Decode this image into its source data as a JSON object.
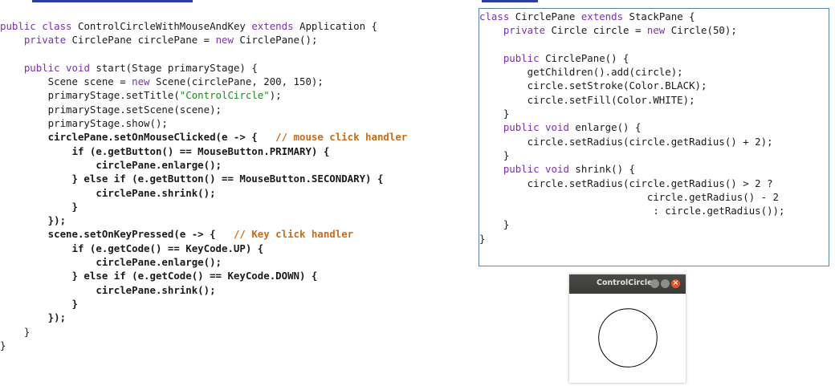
{
  "window": {
    "title": "ControlCircle",
    "close_glyph": "×",
    "circle_radius": 50
  },
  "left_code": [
    [
      {
        "t": "public class ",
        "c": "kw"
      },
      {
        "t": "ControlCircleWithMouseAndKey "
      },
      {
        "t": "extends ",
        "c": "kw"
      },
      {
        "t": "Application {"
      }
    ],
    [
      {
        "t": "    "
      },
      {
        "t": "private ",
        "c": "kw"
      },
      {
        "t": "CirclePane circlePane = "
      },
      {
        "t": "new ",
        "c": "kw"
      },
      {
        "t": "CirclePane();"
      }
    ],
    [],
    [
      {
        "t": "    "
      },
      {
        "t": "public void ",
        "c": "kw"
      },
      {
        "t": "start(Stage primaryStage) {"
      }
    ],
    [
      {
        "t": "        Scene scene = "
      },
      {
        "t": "new ",
        "c": "kw"
      },
      {
        "t": "Scene(circlePane, 200, 150);"
      }
    ],
    [
      {
        "t": "        primaryStage.setTitle("
      },
      {
        "t": "\"ControlCircle\"",
        "c": "str"
      },
      {
        "t": ");"
      }
    ],
    [
      {
        "t": "        primaryStage.setScene(scene);"
      }
    ],
    [
      {
        "t": "        primaryStage.show();"
      }
    ],
    [
      {
        "t": "        circlePane.setOnMouseClicked(e -> {   ",
        "c": "b"
      },
      {
        "t": "// mouse click handler",
        "c": "cm b"
      }
    ],
    [
      {
        "t": "            if (e.getButton() == MouseButton.PRIMARY) {",
        "c": "b"
      }
    ],
    [
      {
        "t": "                circlePane.enlarge();",
        "c": "b"
      }
    ],
    [
      {
        "t": "            } else if (e.getButton() == MouseButton.SECONDARY) {",
        "c": "b"
      }
    ],
    [
      {
        "t": "                circlePane.shrink();",
        "c": "b"
      }
    ],
    [
      {
        "t": "            }",
        "c": "b"
      }
    ],
    [
      {
        "t": "        });",
        "c": "b"
      }
    ],
    [
      {
        "t": "        scene.setOnKeyPressed(e -> {   ",
        "c": "b"
      },
      {
        "t": "// Key click handler",
        "c": "cm b"
      }
    ],
    [
      {
        "t": "            if (e.getCode() == KeyCode.UP) {",
        "c": "b"
      }
    ],
    [
      {
        "t": "                circlePane.enlarge();",
        "c": "b"
      }
    ],
    [
      {
        "t": "            } else if (e.getCode() == KeyCode.DOWN) {",
        "c": "b"
      }
    ],
    [
      {
        "t": "                circlePane.shrink();",
        "c": "b"
      }
    ],
    [
      {
        "t": "            }",
        "c": "b"
      }
    ],
    [
      {
        "t": "        });",
        "c": "b"
      }
    ],
    [
      {
        "t": "    }"
      }
    ],
    [
      {
        "t": "}"
      }
    ]
  ],
  "right_code": [
    [
      {
        "t": "class ",
        "c": "kw"
      },
      {
        "t": "CirclePane "
      },
      {
        "t": "extends ",
        "c": "kw"
      },
      {
        "t": "StackPane {"
      }
    ],
    [
      {
        "t": "    "
      },
      {
        "t": "private ",
        "c": "kw"
      },
      {
        "t": "Circle circle = "
      },
      {
        "t": "new ",
        "c": "kw"
      },
      {
        "t": "Circle(50);"
      }
    ],
    [],
    [
      {
        "t": "    "
      },
      {
        "t": "public ",
        "c": "kw"
      },
      {
        "t": "CirclePane() {"
      }
    ],
    [
      {
        "t": "        getChildren().add(circle);"
      }
    ],
    [
      {
        "t": "        circle.setStroke(Color.BLACK);"
      }
    ],
    [
      {
        "t": "        circle.setFill(Color.WHITE);"
      }
    ],
    [
      {
        "t": "    }"
      }
    ],
    [
      {
        "t": "    "
      },
      {
        "t": "public void ",
        "c": "kw"
      },
      {
        "t": "enlarge() {"
      }
    ],
    [
      {
        "t": "        circle.setRadius(circle.getRadius() + 2);"
      }
    ],
    [
      {
        "t": "    }"
      }
    ],
    [
      {
        "t": "    "
      },
      {
        "t": "public void ",
        "c": "kw"
      },
      {
        "t": "shrink() {"
      }
    ],
    [
      {
        "t": "        circle.setRadius(circle.getRadius() > 2 ?"
      }
    ],
    [
      {
        "t": "                            circle.getRadius() - 2"
      }
    ],
    [
      {
        "t": "                             : circle.getRadius());"
      }
    ],
    [
      {
        "t": "    }"
      }
    ],
    [
      {
        "t": "}"
      }
    ]
  ],
  "colors": {
    "keyword": "#7a2fb5",
    "string": "#1f8a1f",
    "comment": "#d06a12",
    "box_border": "#5a86ad",
    "header_bar": "#2a3f9e"
  }
}
